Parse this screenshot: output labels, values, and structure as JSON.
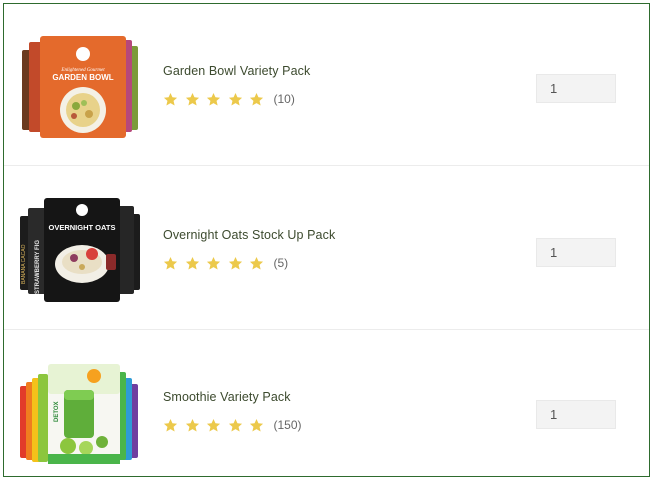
{
  "products": [
    {
      "name": "Garden Bowl Variety Pack",
      "rating_stars": 5,
      "reviews": "(10)",
      "quantity": "1",
      "image": {
        "pouch_label": "GARDEN BOWL",
        "colors": [
          "#6b3a1f",
          "#c24a2a",
          "#e46a2c",
          "#f0842c",
          "#7c9b3a",
          "#b6487a"
        ]
      }
    },
    {
      "name": "Overnight Oats Stock Up Pack",
      "rating_stars": 5,
      "reviews": "(5)",
      "quantity": "1",
      "image": {
        "pouch_label": "OVERNIGHT OATS",
        "side_text": "STRAWBERRY FIG",
        "left_text": "BANANA CACAO",
        "colors": [
          "#1c1c1c",
          "#2a2a2a",
          "#151515"
        ]
      }
    },
    {
      "name": "Smoothie Variety Pack",
      "rating_stars": 5,
      "reviews": "(150)",
      "quantity": "1",
      "image": {
        "pouch_label": "DETOX",
        "colors": [
          "#e23b2a",
          "#f07d1f",
          "#f4c21a",
          "#8cc63e",
          "#4ab54a",
          "#2e9bd6",
          "#6f3fa0"
        ]
      }
    }
  ],
  "colors": {
    "star": "#ecc94b",
    "title": "#3c4a2e",
    "border": "#2e6b2e"
  },
  "icons": {
    "rating": "star-icon"
  }
}
